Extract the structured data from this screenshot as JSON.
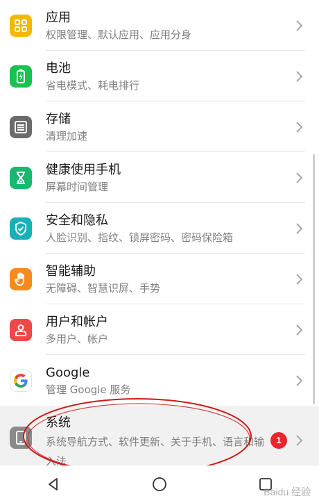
{
  "colors": {
    "apps": "#f5b800",
    "battery": "#19c250",
    "storage": "#6b6b6b",
    "health": "#19b870",
    "security": "#19b0b8",
    "assist": "#f58a1f",
    "users": "#f04848",
    "system": "#8a8a8a",
    "badge": "#e8262e",
    "annotation": "#cc1a1a"
  },
  "items": [
    {
      "title": "应用",
      "sub": "权限管理、默认应用、应用分身",
      "icon": "apps-grid-icon"
    },
    {
      "title": "电池",
      "sub": "省电模式、耗电排行",
      "icon": "battery-icon"
    },
    {
      "title": "存储",
      "sub": "清理加速",
      "icon": "storage-icon"
    },
    {
      "title": "健康使用手机",
      "sub": "屏幕时间管理",
      "icon": "hourglass-icon"
    },
    {
      "title": "安全和隐私",
      "sub": "人脸识别、指纹、锁屏密码、密码保险箱",
      "icon": "shield-icon"
    },
    {
      "title": "智能辅助",
      "sub": "无障碍、智慧识屏、手势",
      "icon": "hand-icon"
    },
    {
      "title": "用户和帐户",
      "sub": "多用户、帐户",
      "icon": "user-icon"
    },
    {
      "title": "Google",
      "sub": "管理 Google 服务",
      "icon": "google-icon"
    },
    {
      "title": "系统",
      "sub": "系统导航方式、软件更新、关于手机、语言和输入法",
      "icon": "system-phone-icon",
      "badge": "1"
    }
  ],
  "watermark": "Baidu 经验"
}
